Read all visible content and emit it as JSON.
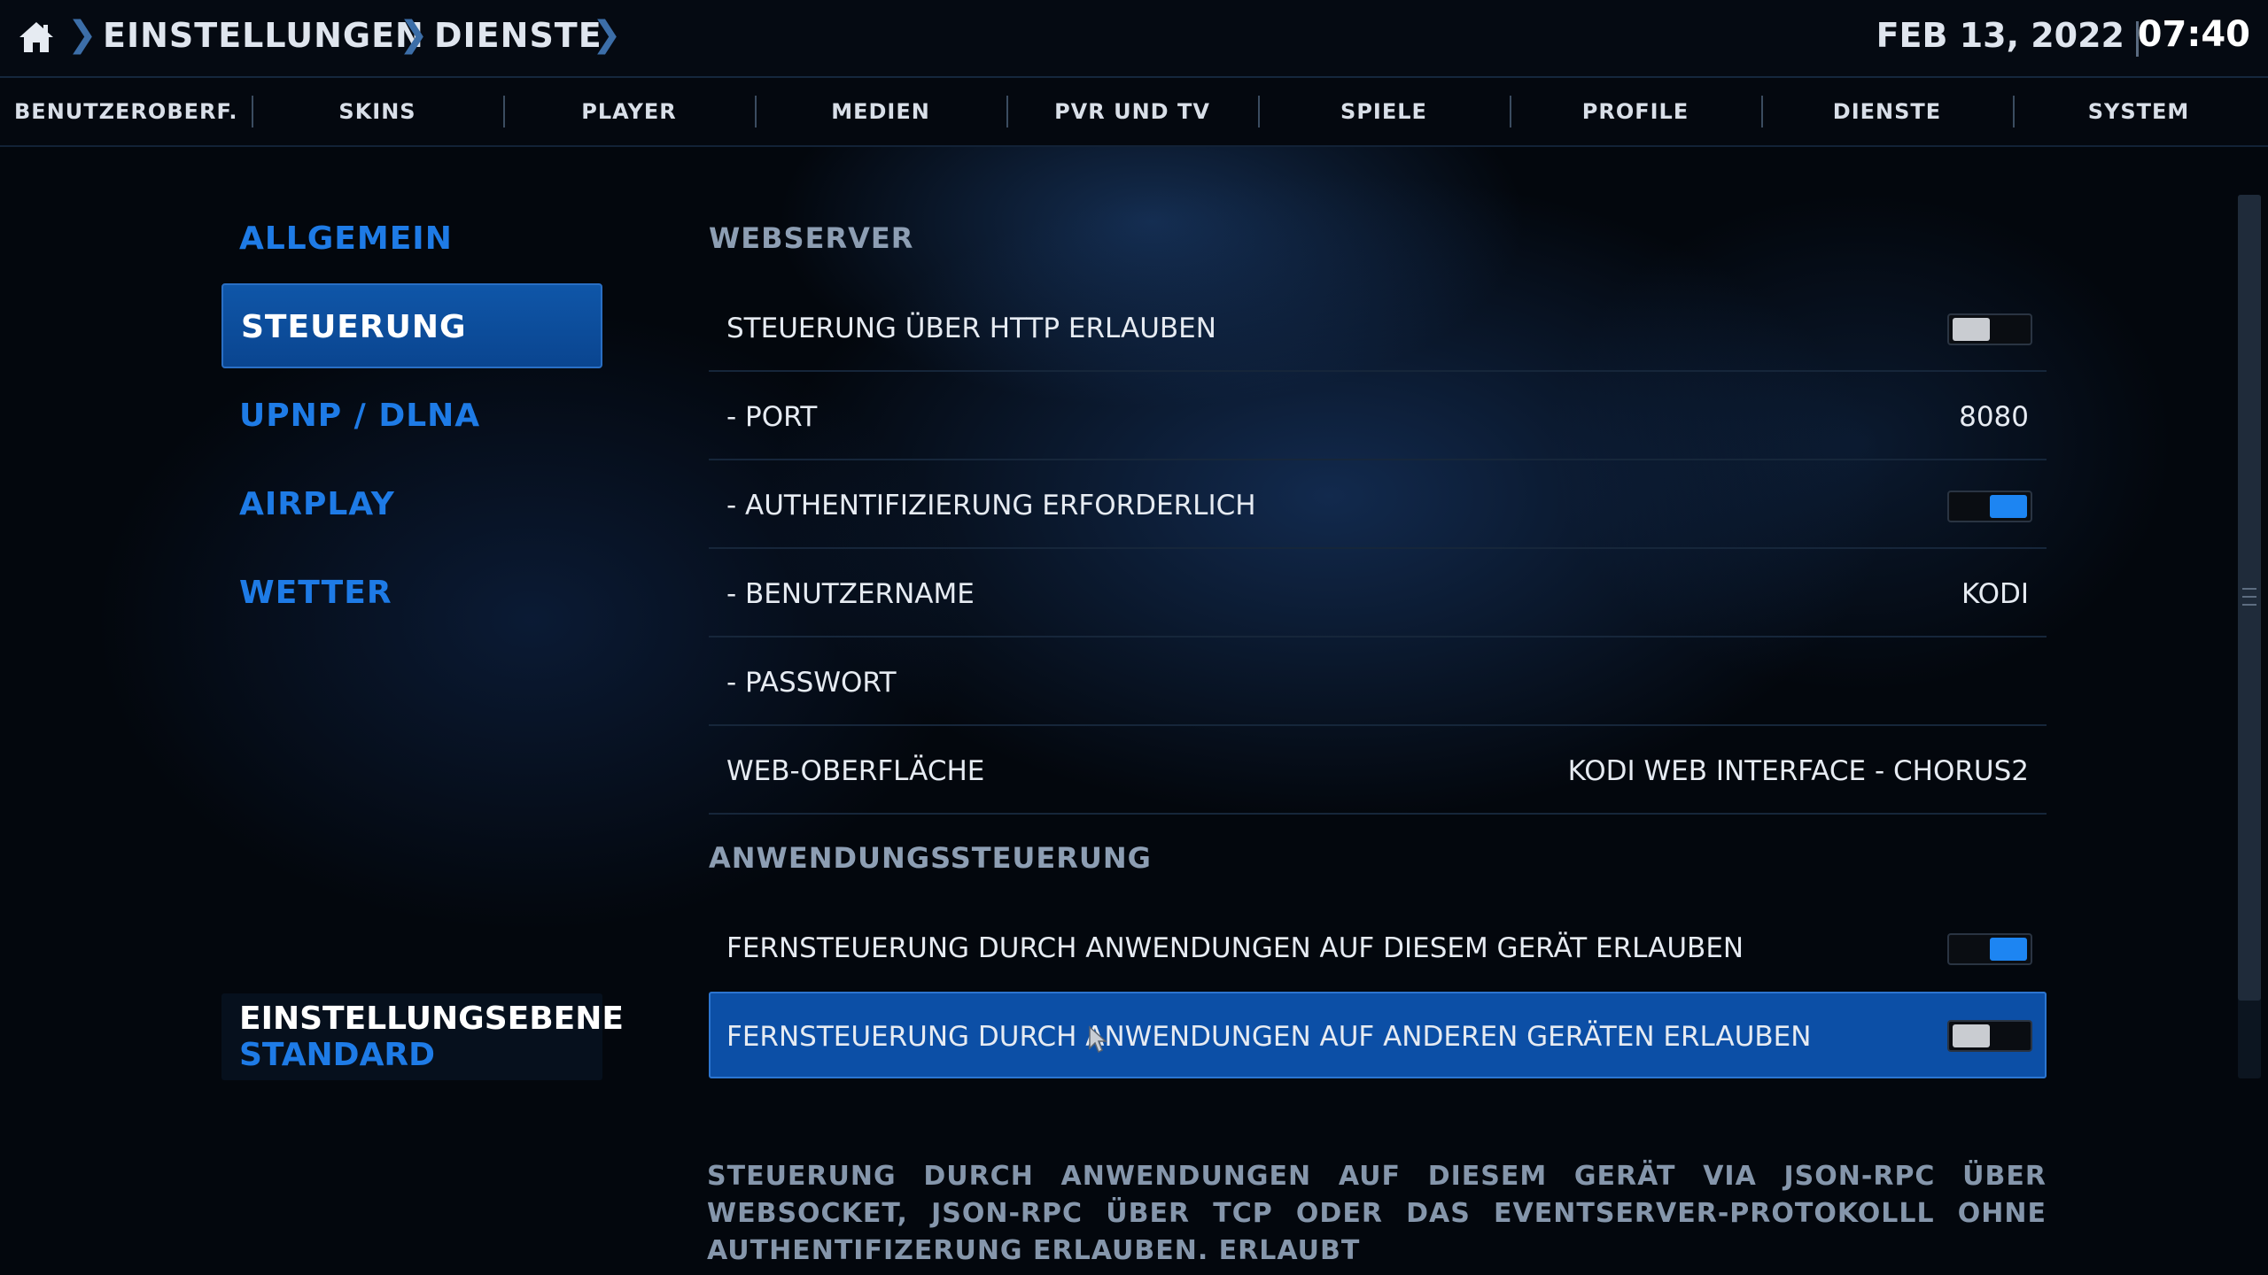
{
  "header": {
    "breadcrumbs": [
      "EINSTELLUNGEN",
      "DIENSTE"
    ],
    "date": "FEB 13, 2022",
    "time": "07:40"
  },
  "categories": [
    {
      "label": "BENUTZEROBERF..."
    },
    {
      "label": "SKINS"
    },
    {
      "label": "PLAYER"
    },
    {
      "label": "MEDIEN"
    },
    {
      "label": "PVR UND TV"
    },
    {
      "label": "SPIELE"
    },
    {
      "label": "PROFILE"
    },
    {
      "label": "DIENSTE"
    },
    {
      "label": "SYSTEM"
    }
  ],
  "sidebar": {
    "items": [
      {
        "label": "ALLGEMEIN",
        "active": false
      },
      {
        "label": "STEUERUNG",
        "active": true
      },
      {
        "label": "UPNP / DLNA",
        "active": false
      },
      {
        "label": "AIRPLAY",
        "active": false
      },
      {
        "label": "WETTER",
        "active": false
      }
    ],
    "level_title": "EINSTELLUNGSEBENE",
    "level_value": "STANDARD"
  },
  "content": {
    "sections": [
      {
        "title": "WEBSERVER",
        "rows": [
          {
            "label": "STEUERUNG ÜBER HTTP ERLAUBEN",
            "toggle": "off"
          },
          {
            "label": "- PORT",
            "value": "8080"
          },
          {
            "label": "- AUTHENTIFIZIERUNG ERFORDERLICH",
            "toggle": "on"
          },
          {
            "label": "- BENUTZERNAME",
            "value": "KODI"
          },
          {
            "label": "- PASSWORT",
            "value": ""
          },
          {
            "label": "WEB-OBERFLÄCHE",
            "value": "KODI WEB INTERFACE - CHORUS2"
          }
        ]
      },
      {
        "title": "ANWENDUNGSSTEUERUNG",
        "rows": [
          {
            "label": "FERNSTEUERUNG DURCH ANWENDUNGEN AUF DIESEM GERÄT ERLAUBEN",
            "toggle": "on"
          },
          {
            "label": "FERNSTEUERUNG DURCH ANWENDUNGEN AUF ANDEREN GERÄTEN ERLAUBEN",
            "toggle": "off",
            "selected": true
          }
        ]
      }
    ],
    "description": "STEUERUNG DURCH ANWENDUNGEN AUF DIESEM GERÄT VIA JSON-RPC ÜBER WEBSOCKET, JSON-RPC ÜBER TCP ODER DAS EVENTSERVER-PROTOKOLLL OHNE AUTHENTIFIZERUNG ERLAUBEN. ERLAUBT"
  },
  "colors": {
    "accent": "#1e7be6",
    "selection": "#0c4fa6",
    "toggle_on": "#1d85f2",
    "toggle_off": "#c9ccd1",
    "section_title": "#8d9eb3"
  },
  "icons": {
    "home": "home-icon",
    "breadcrumb_separator": "chevron-right-icon",
    "mouse_pointer": "mouse-cursor-icon"
  }
}
